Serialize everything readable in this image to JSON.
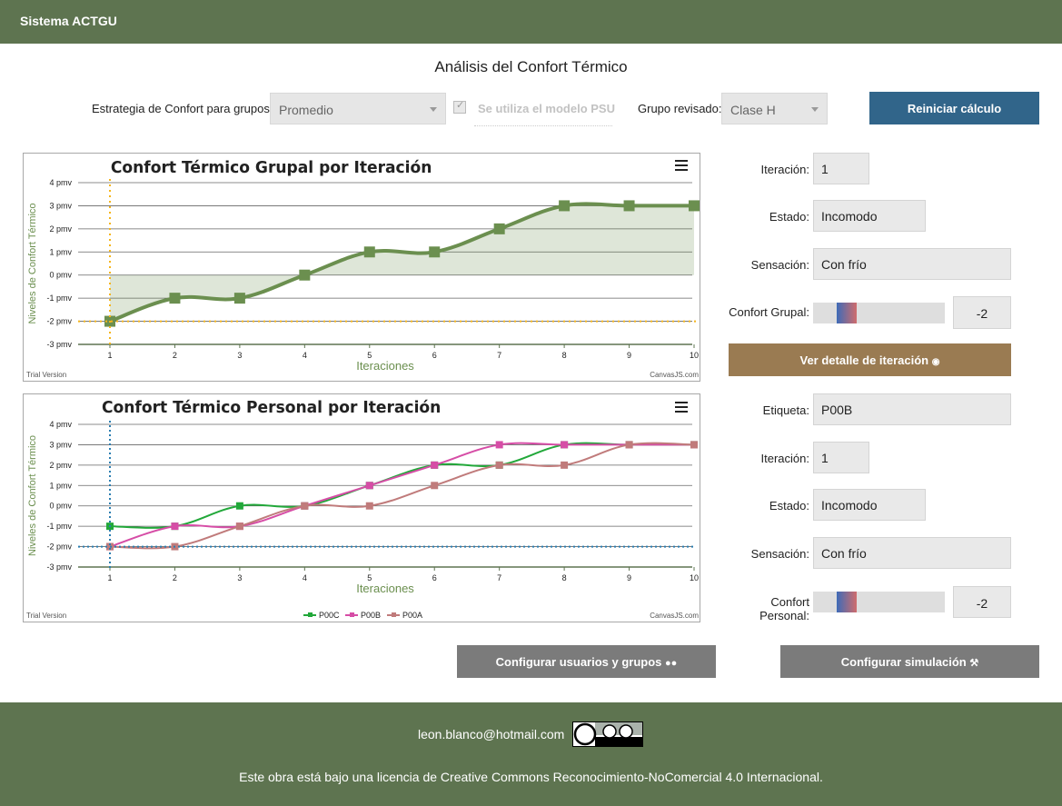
{
  "app": {
    "title": "Sistema ACTGU"
  },
  "page": {
    "title": "Análisis del Confort Térmico"
  },
  "controls": {
    "strategy_label": "Estrategia de Confort para grupos:",
    "strategy_value": "Promedio",
    "psu_label": "Se utiliza el modelo PSU",
    "psu_checked": true,
    "group_label": "Grupo revisado:",
    "group_value": "Clase H",
    "reset_label": "Reiniciar cálculo"
  },
  "chart_data": [
    {
      "type": "area",
      "title": "Confort Térmico Grupal por Iteración",
      "xlabel": "Iteraciones",
      "ylabel": "Niveles de Confort Térmico",
      "x": [
        1,
        2,
        3,
        4,
        5,
        6,
        7,
        8,
        9,
        10
      ],
      "series": [
        {
          "values": [
            -2,
            -1,
            -1,
            0,
            1,
            1,
            2,
            3,
            3,
            3
          ]
        }
      ],
      "ylim": [
        -3,
        4
      ],
      "yticks": [
        "-3 pmv",
        "-2 pmv",
        "-1 pmv",
        "0 pmv",
        "1 pmv",
        "2 pmv",
        "3 pmv",
        "4 pmv"
      ],
      "xticks": [
        "1",
        "2",
        "3",
        "4",
        "5",
        "6",
        "7",
        "8",
        "9",
        "10"
      ],
      "crosshair": {
        "x": 1,
        "y": -2
      },
      "grid": true,
      "watermark_left": "Trial Version",
      "watermark_right": "CanvasJS.com",
      "color": "#6b8f4f",
      "crosshair_color": "#f5b51b"
    },
    {
      "type": "line",
      "title": "Confort Térmico Personal por Iteración",
      "xlabel": "Iteraciones",
      "ylabel": "Niveles de Confort Térmico",
      "x": [
        1,
        2,
        3,
        4,
        5,
        6,
        7,
        8,
        9,
        10
      ],
      "series": [
        {
          "name": "P00C",
          "color": "#22a83a",
          "values": [
            -1,
            -1,
            0,
            0,
            1,
            2,
            2,
            3,
            3,
            3
          ]
        },
        {
          "name": "P00B",
          "color": "#d64da6",
          "values": [
            -2,
            -1,
            -1,
            0,
            1,
            2,
            3,
            3,
            3,
            3
          ]
        },
        {
          "name": "P00A",
          "color": "#c07b7b",
          "values": [
            -2,
            -2,
            -1,
            0,
            0,
            1,
            2,
            2,
            3,
            3
          ]
        }
      ],
      "ylim": [
        -3,
        4
      ],
      "yticks": [
        "-3 pmv",
        "-2 pmv",
        "-1 pmv",
        "0 pmv",
        "1 pmv",
        "2 pmv",
        "3 pmv",
        "4 pmv"
      ],
      "xticks": [
        "1",
        "2",
        "3",
        "4",
        "5",
        "6",
        "7",
        "8",
        "9",
        "10"
      ],
      "crosshair": {
        "x": 1,
        "y": -2
      },
      "grid": true,
      "legend": "bottom-center",
      "watermark_left": "Trial Version",
      "watermark_right": "CanvasJS.com",
      "crosshair_color": "#2a7db0"
    }
  ],
  "group_panel": {
    "iteration_label": "Iteración:",
    "iteration_value": "1",
    "state_label": "Estado:",
    "state_value": "Incomodo",
    "sensation_label": "Sensación:",
    "sensation_value": "Con frío",
    "comfort_label": "Confort Grupal:",
    "comfort_value": "-2",
    "detail_button": "Ver detalle de iteración"
  },
  "personal_panel": {
    "tag_label": "Etiqueta:",
    "tag_value": "P00B",
    "iteration_label": "Iteración:",
    "iteration_value": "1",
    "state_label": "Estado:",
    "state_value": "Incomodo",
    "sensation_label": "Sensación:",
    "sensation_value": "Con frío",
    "comfort_label": "Confort Personal:",
    "comfort_value": "-2"
  },
  "buttons": {
    "users_groups": "Configurar usuarios y grupos",
    "simulation": "Configurar simulación"
  },
  "footer": {
    "email": "leon.blanco@hotmail.com",
    "license": "Este obra está bajo una licencia de Creative Commons Reconocimiento-NoComercial 4.0 Internacional.",
    "cc_badge": "cc by nc"
  },
  "colors": {
    "brand": "#5e7450",
    "primary_button": "#31658a",
    "detail_button": "#9a7b52",
    "secondary_button": "#7b7b7b"
  }
}
